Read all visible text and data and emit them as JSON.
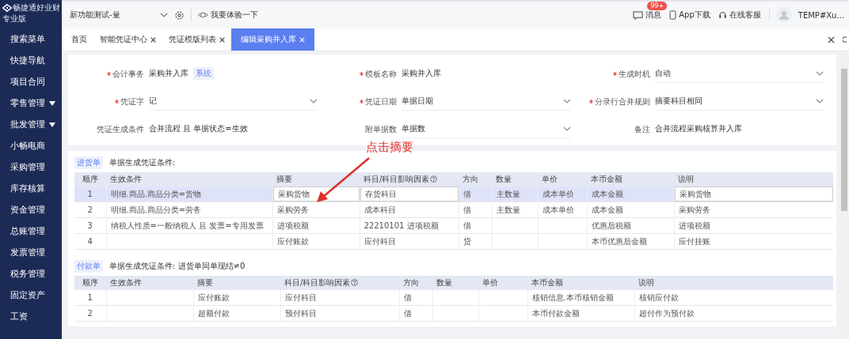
{
  "sidebar": {
    "brand": "畅捷通好业财",
    "edition": "专业版",
    "items": [
      {
        "label": "搜索菜单",
        "has_submenu": false
      },
      {
        "label": "快捷导航",
        "has_submenu": false
      },
      {
        "label": "项目合同",
        "has_submenu": false
      },
      {
        "label": "零售管理",
        "has_submenu": true
      },
      {
        "label": "批发管理",
        "has_submenu": true
      },
      {
        "label": "小畅电商",
        "has_submenu": false
      },
      {
        "label": "采购管理",
        "has_submenu": false
      },
      {
        "label": "库存核算",
        "has_submenu": false
      },
      {
        "label": "资金管理",
        "has_submenu": false
      },
      {
        "label": "总账管理",
        "has_submenu": false
      },
      {
        "label": "发票管理",
        "has_submenu": false
      },
      {
        "label": "税务管理",
        "has_submenu": false
      },
      {
        "label": "固定资产",
        "has_submenu": false
      },
      {
        "label": "工资",
        "has_submenu": false
      }
    ]
  },
  "topbar": {
    "account": "新功能测试-量",
    "try_button": "我要体验一下",
    "messages": {
      "label": "消息",
      "badge": "99+"
    },
    "app_download": "App下载",
    "support": "在线客服",
    "user": "TEMP#Xu..."
  },
  "tabs": [
    {
      "label": "首页",
      "closable": false,
      "selected": false
    },
    {
      "label": "智能凭证中心",
      "closable": true,
      "selected": false
    },
    {
      "label": "凭证模版列表",
      "closable": true,
      "selected": false
    },
    {
      "label": "编辑采购并入库",
      "closable": true,
      "selected": true
    }
  ],
  "form": [
    [
      {
        "label": "会计事务",
        "required": true,
        "value": "采购并入库",
        "tag": "系统",
        "kind": "text"
      },
      {
        "label": "模板名称",
        "required": true,
        "value": "采购并入库",
        "kind": "text"
      },
      {
        "label": "生成时机",
        "required": true,
        "value": "自动",
        "kind": "select"
      }
    ],
    [
      {
        "label": "凭证字",
        "required": true,
        "value": "记",
        "kind": "select"
      },
      {
        "label": "凭证日期",
        "required": true,
        "value": "单据日期",
        "kind": "select"
      },
      {
        "label": "分录行合并规则",
        "required": true,
        "value": "摘要科目相同",
        "kind": "select"
      }
    ],
    [
      {
        "label": "凭证生成条件",
        "required": false,
        "value": "合并流程 且 单据状态=生效",
        "kind": "text"
      },
      {
        "label": "附单据数",
        "required": false,
        "value": "单据数",
        "kind": "select"
      },
      {
        "label": "备注",
        "required": false,
        "value": "合并流程采购核算并入库",
        "kind": "text"
      }
    ]
  ],
  "annotation": "点击摘要",
  "sections": [
    {
      "tag": "进货单",
      "condition": "单据生成凭证条件:",
      "columns": [
        {
          "label": "顺序",
          "help": false,
          "editable": false
        },
        {
          "label": "生效条件",
          "help": false,
          "editable": false
        },
        {
          "label": "摘要",
          "help": false,
          "editable": true
        },
        {
          "label": "科目/科目影响因素",
          "help": true,
          "editable": true
        },
        {
          "label": "方向",
          "help": false,
          "editable": false
        },
        {
          "label": "数量",
          "help": false,
          "editable": false
        },
        {
          "label": "单价",
          "help": false,
          "editable": false
        },
        {
          "label": "本币金额",
          "help": false,
          "editable": false
        },
        {
          "label": "说明",
          "help": false,
          "editable": true
        }
      ],
      "rows": [
        {
          "selected": true,
          "cells": [
            "1",
            "明细.商品.商品分类=货物",
            "采购货物",
            "存货科目",
            "借",
            "主数量",
            "成本单价",
            "成本金额",
            "采购货物"
          ]
        },
        {
          "selected": false,
          "cells": [
            "2",
            "明细.商品.商品分类=劳务",
            "采购劳务",
            "成本科目",
            "借",
            "主数量",
            "成本单价",
            "成本金额",
            "采购劳务"
          ]
        },
        {
          "selected": false,
          "cells": [
            "3",
            "纳税人性质=一般纳税人 且 发票=专用发票",
            "进项税额",
            "22210101 进项税额",
            "借",
            "",
            "",
            "优惠后税额",
            "进项税额"
          ]
        },
        {
          "selected": false,
          "cells": [
            "4",
            "",
            "应付账款",
            "应付科目",
            "贷",
            "",
            "",
            "本币优惠后金额",
            "应付挂账"
          ]
        }
      ]
    },
    {
      "tag": "付款单",
      "condition": "单据生成凭证条件: 进货单同单现结≠0",
      "columns": [
        {
          "label": "顺序",
          "help": false
        },
        {
          "label": "生效条件",
          "help": false
        },
        {
          "label": "摘要",
          "help": false
        },
        {
          "label": "科目/科目影响因素",
          "help": true
        },
        {
          "label": "方向",
          "help": false
        },
        {
          "label": "数量",
          "help": false
        },
        {
          "label": "单价",
          "help": false
        },
        {
          "label": "本币金额",
          "help": false
        },
        {
          "label": "说明",
          "help": false
        }
      ],
      "rows": [
        {
          "selected": false,
          "cells": [
            "1",
            "",
            "应付账款",
            "应付科目",
            "借",
            "",
            "",
            "核销信息.本币核销金额",
            "核销应付款"
          ]
        },
        {
          "selected": false,
          "cells": [
            "2",
            "",
            "超额付款",
            "预付科目",
            "借",
            "",
            "",
            "本币付款金额",
            "超付作为预付款"
          ]
        }
      ]
    }
  ]
}
